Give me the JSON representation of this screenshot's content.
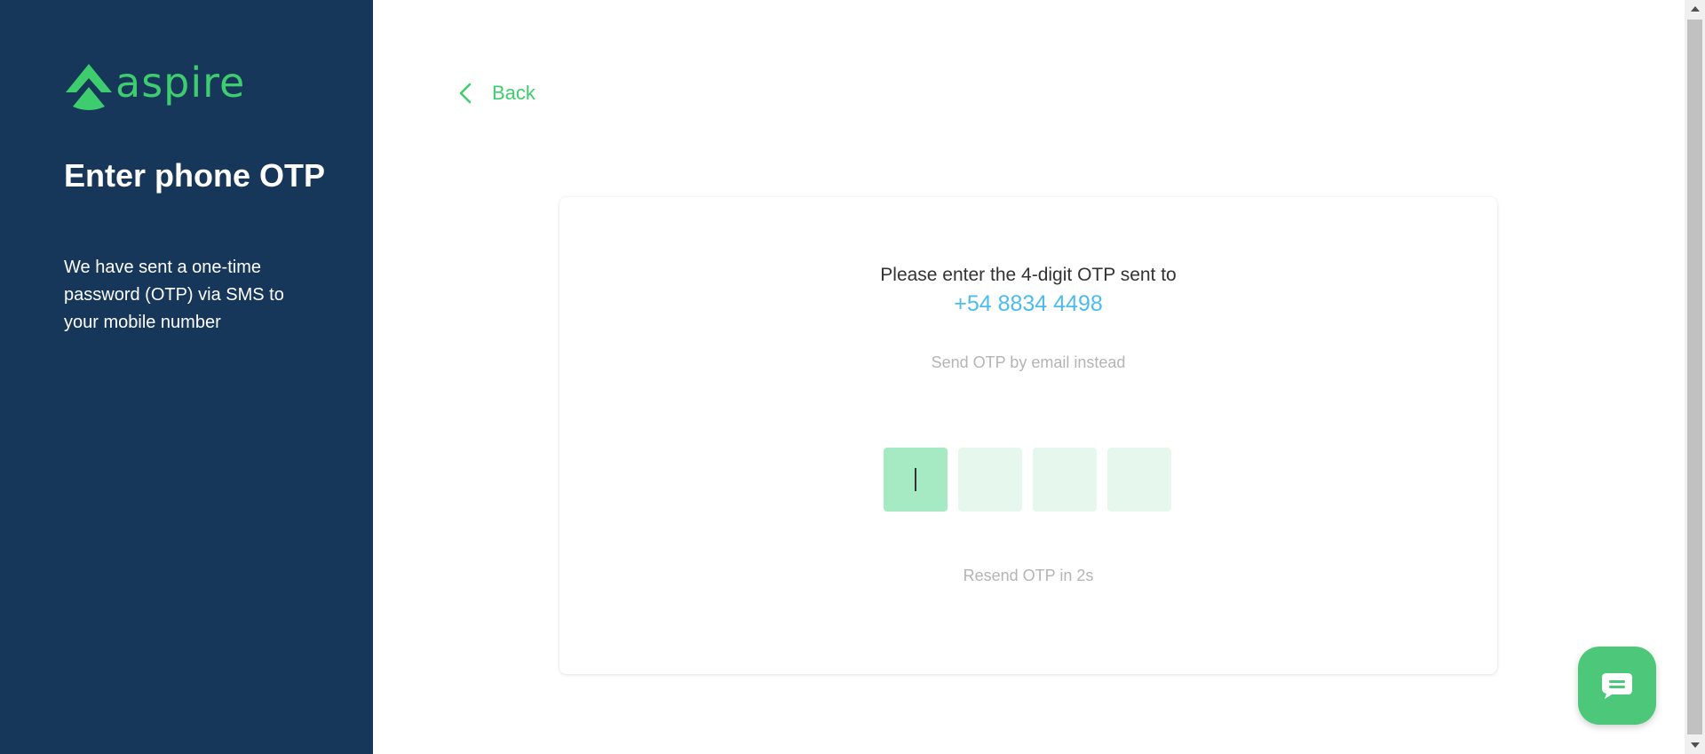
{
  "brand": {
    "name": "aspire",
    "color": "#3dcd6e",
    "logo_icon": "aspire-mountain-logo-icon"
  },
  "sidebar": {
    "title": "Enter phone OTP",
    "description": "We have sent a one-time password (OTP) via SMS to your mobile number",
    "background": "#16365a"
  },
  "nav": {
    "back_label": "Back",
    "back_icon": "chevron-left-icon"
  },
  "otp_card": {
    "prompt": "Please enter the 4-digit OTP sent to",
    "phone": "+54 8834 4498",
    "email_alt_label": "Send OTP by email instead",
    "digits": [
      "",
      "",
      "",
      ""
    ],
    "active_index": 0,
    "resend_text": "Resend OTP in 2s"
  },
  "chat": {
    "icon": "chat-bubble-icon",
    "color": "#4dc87a"
  }
}
